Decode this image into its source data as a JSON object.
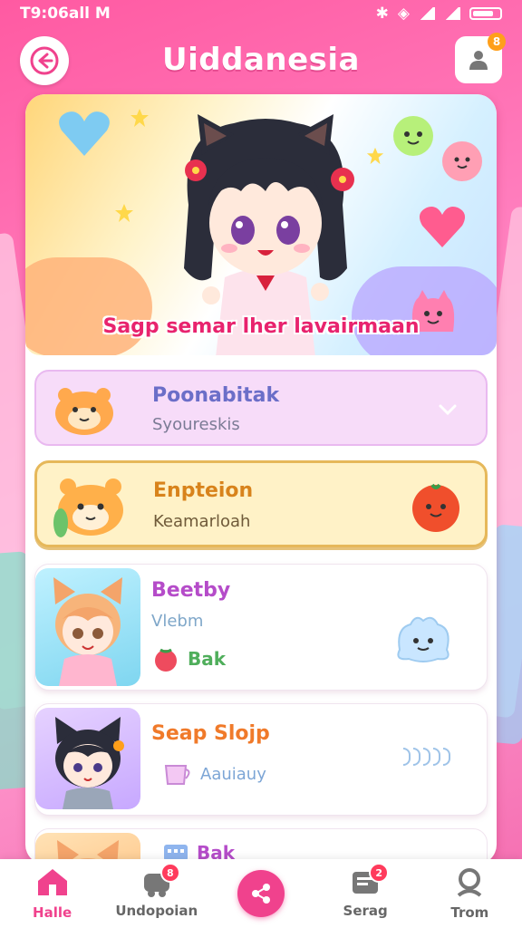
{
  "status_bar": {
    "time": "T9:06all M"
  },
  "header": {
    "title": "Uiddanesia",
    "profile_badge": "8"
  },
  "hero": {
    "caption": "Sagp semar lher lavairmaan"
  },
  "list": {
    "item1": {
      "title": "Poonabitak",
      "subtitle": "Syoureskis"
    },
    "item2": {
      "title": "Enpteion",
      "subtitle": "Keamarloah"
    },
    "item3": {
      "title": "Beetby",
      "subtitle": "Vlebm",
      "tag": "Bak"
    },
    "item4": {
      "title": "Seap Slojp",
      "tag": "Aauiauy"
    },
    "item5": {
      "tag": "Bak"
    }
  },
  "nav": {
    "items": [
      {
        "label": "Halle",
        "active": true
      },
      {
        "label": "Undopoian",
        "badge": "8"
      },
      {
        "label": ""
      },
      {
        "label": "Serag",
        "badge": "2"
      },
      {
        "label": "Trom"
      }
    ]
  },
  "colors": {
    "accent": "#f0428d",
    "header_bg": "#ff5aa2"
  }
}
